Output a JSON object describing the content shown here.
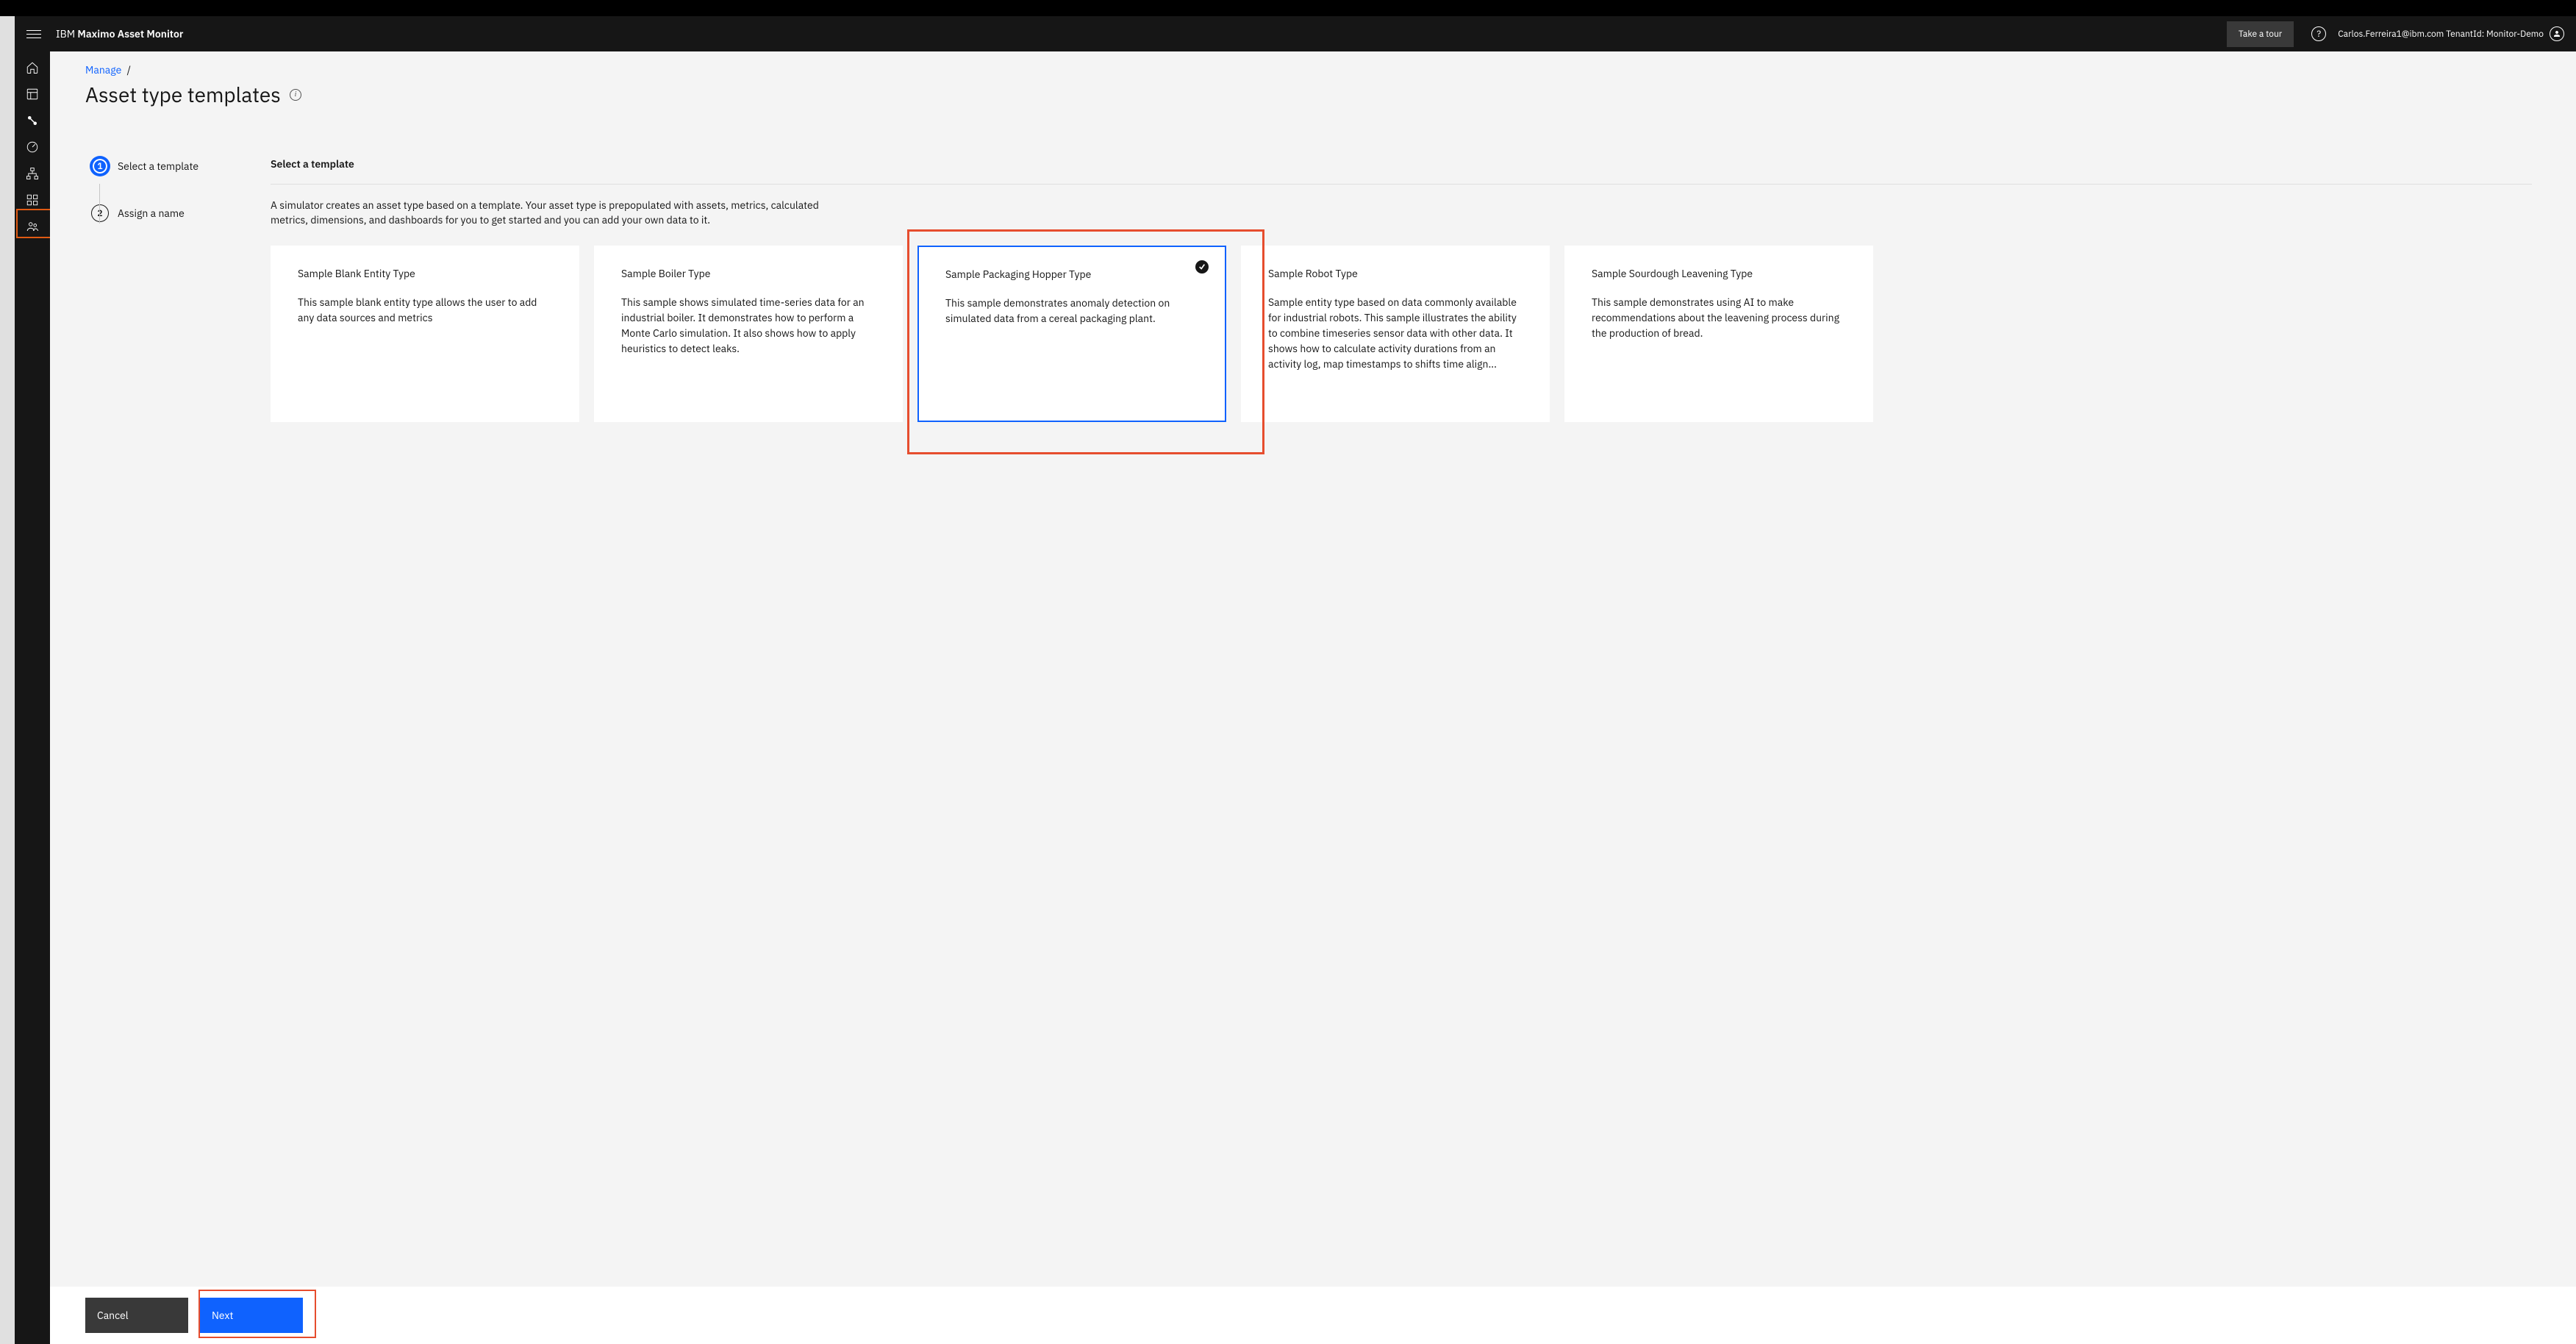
{
  "header": {
    "brand_prefix": "IBM ",
    "brand_bold": "Maximo Asset Monitor",
    "tour_label": "Take a tour",
    "user_text": "Carlos.Ferreira1@ibm.com TenantId: Monitor-Demo"
  },
  "breadcrumb": {
    "root": "Manage",
    "sep": "/"
  },
  "page_title": "Asset type templates",
  "steps": [
    {
      "num": "1",
      "label": "Select a template",
      "state": "active"
    },
    {
      "num": "2",
      "label": "Assign a name",
      "state": "inactive"
    }
  ],
  "section": {
    "title": "Select a template",
    "description": "A simulator creates an asset type based on a template. Your asset type is prepopulated with assets, metrics, calculated metrics, dimensions, and dashboards for you to get started and you can add your own data to it."
  },
  "cards": [
    {
      "title": "Sample Blank Entity Type",
      "desc": "This sample blank entity type allows the user to add any data sources and metrics",
      "selected": false
    },
    {
      "title": "Sample Boiler Type",
      "desc": "This sample shows simulated time-series data for an industrial boiler. It demonstrates how to perform a Monte Carlo simulation. It also shows how to apply heuristics to detect leaks.",
      "selected": false
    },
    {
      "title": "Sample Packaging Hopper Type",
      "desc": "This sample demonstrates anomaly detection on simulated data from a cereal packaging plant.",
      "selected": true
    },
    {
      "title": "Sample Robot Type",
      "desc": "Sample entity type based on data commonly available for industrial robots. This sample illustrates the ability to combine timeseries sensor data with other data. It shows how to calculate activity durations from an activity log, map timestamps to shifts time align...",
      "selected": false
    },
    {
      "title": "Sample Sourdough Leavening Type",
      "desc": "This sample demonstrates using AI to make recommendations about the leavening process during the production of bread.",
      "selected": false
    }
  ],
  "footer": {
    "cancel": "Cancel",
    "next": "Next"
  },
  "rail_icons": [
    "home-icon",
    "dashboard-icon",
    "link-icon",
    "gauge-icon",
    "hierarchy-icon",
    "categories-icon",
    "users-icon"
  ]
}
